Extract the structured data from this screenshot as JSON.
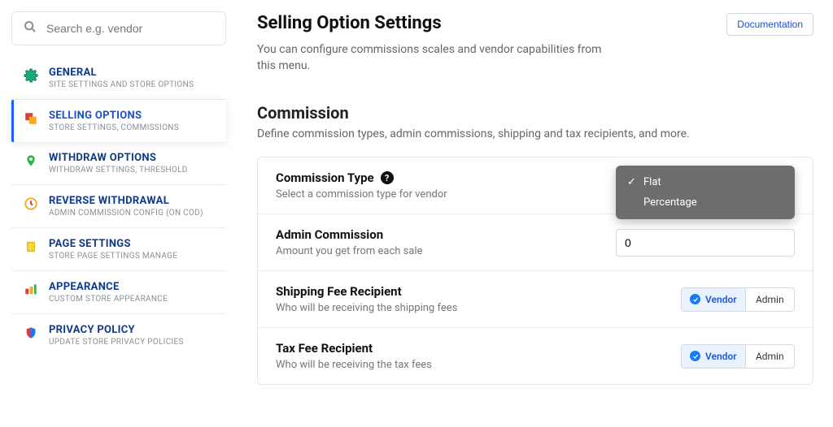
{
  "search": {
    "placeholder": "Search e.g. vendor"
  },
  "sidebar": {
    "items": [
      {
        "title": "GENERAL",
        "sub": "SITE SETTINGS AND STORE OPTIONS"
      },
      {
        "title": "SELLING OPTIONS",
        "sub": "STORE SETTINGS, COMMISSIONS"
      },
      {
        "title": "WITHDRAW OPTIONS",
        "sub": "WITHDRAW SETTINGS, THRESHOLD"
      },
      {
        "title": "REVERSE WITHDRAWAL",
        "sub": "ADMIN COMMISSION CONFIG (ON COD)"
      },
      {
        "title": "PAGE SETTINGS",
        "sub": "STORE PAGE SETTINGS MANAGE"
      },
      {
        "title": "APPEARANCE",
        "sub": "CUSTOM STORE APPEARANCE"
      },
      {
        "title": "PRIVACY POLICY",
        "sub": "UPDATE STORE PRIVACY POLICIES"
      }
    ]
  },
  "header": {
    "title": "Selling Option Settings",
    "desc": "You can configure commissions scales and vendor capabilities from this menu.",
    "doc_btn": "Documentation"
  },
  "section": {
    "title": "Commission",
    "desc": "Define commission types, admin commissions, shipping and tax recipients, and more."
  },
  "rows": {
    "commission_type": {
      "label": "Commission Type",
      "hint": "Select a commission type for vendor",
      "options": [
        "Flat",
        "Percentage"
      ],
      "selected": "Flat"
    },
    "admin_commission": {
      "label": "Admin Commission",
      "hint": "Amount you get from each sale",
      "value": "0"
    },
    "shipping_recipient": {
      "label": "Shipping Fee Recipient",
      "hint": "Who will be receiving the shipping fees",
      "options": {
        "vendor": "Vendor",
        "admin": "Admin"
      }
    },
    "tax_recipient": {
      "label": "Tax Fee Recipient",
      "hint": "Who will be receiving the tax fees",
      "options": {
        "vendor": "Vendor",
        "admin": "Admin"
      }
    }
  }
}
